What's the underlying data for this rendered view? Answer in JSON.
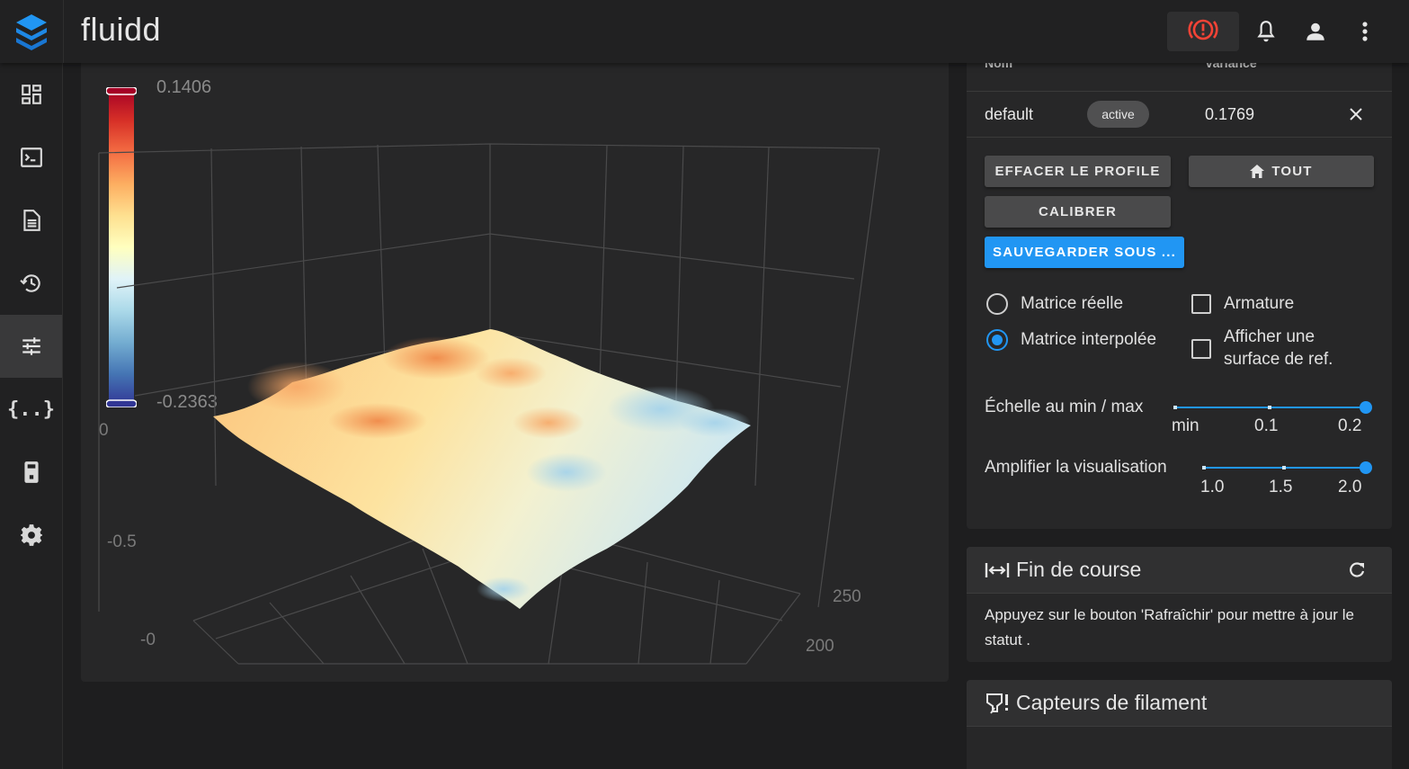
{
  "app": {
    "title": "fluidd"
  },
  "topbar": {
    "icons": [
      "emergency-stop-icon",
      "bell-icon",
      "account-icon",
      "more-vert-icon"
    ]
  },
  "sidebar": {
    "items": [
      {
        "icon": "dashboard-icon",
        "active": false
      },
      {
        "icon": "console-icon",
        "active": false
      },
      {
        "icon": "jobs-icon",
        "active": false
      },
      {
        "icon": "history-icon",
        "active": false
      },
      {
        "icon": "tune-icon",
        "active": true
      },
      {
        "icon": "code-braces-icon",
        "active": false
      },
      {
        "icon": "printer-icon",
        "active": false
      },
      {
        "icon": "settings-icon",
        "active": false
      }
    ]
  },
  "mesh": {
    "colorscale_max": "0.1406",
    "colorscale_min": "-0.2363",
    "colors": [
      "#a50026",
      "#d73027",
      "#f46d43",
      "#fdae61",
      "#fee090",
      "#ffffbf",
      "#e0f3f8",
      "#abd9e9",
      "#74add1",
      "#4575b4",
      "#313695"
    ],
    "axis_ticks": {
      "z_top": "0",
      "z_mid": "-0.5",
      "z_bottom": "-0",
      "y_250": "250",
      "y_200": "200"
    }
  },
  "profiles": {
    "header_name": "Nom",
    "header_variance": "Variance",
    "rows": [
      {
        "name": "default",
        "status": "active",
        "variance": "0.1769"
      }
    ]
  },
  "actions": {
    "clear": "EFFACER LE PROFILE",
    "home": "TOUT",
    "calibrate": "CALIBRER",
    "save_as": "SAUVEGARDER SOUS ..."
  },
  "options": {
    "radio_real": "Matrice réelle",
    "radio_interp": "Matrice interpolée",
    "checkbox_wireframe": "Armature",
    "checkbox_flat_line1": "Afficher une",
    "checkbox_flat_line2": "surface de ref.",
    "selected": "interpolated"
  },
  "sliders": {
    "scale": {
      "label": "Échelle au min / max",
      "ticks": [
        "min",
        "0.1",
        "0.2"
      ],
      "value_fraction": 1.0
    },
    "scale_factor": {
      "label": "Amplifier la visualisation",
      "ticks": [
        "1.0",
        "1.5",
        "2.0"
      ],
      "value_fraction": 1.0
    }
  },
  "endstops": {
    "title": "Fin de course",
    "text": "Appuyez sur le bouton 'Rafraîchir' pour mettre à jour le statut ."
  },
  "filament": {
    "title": "Capteurs de filament"
  }
}
